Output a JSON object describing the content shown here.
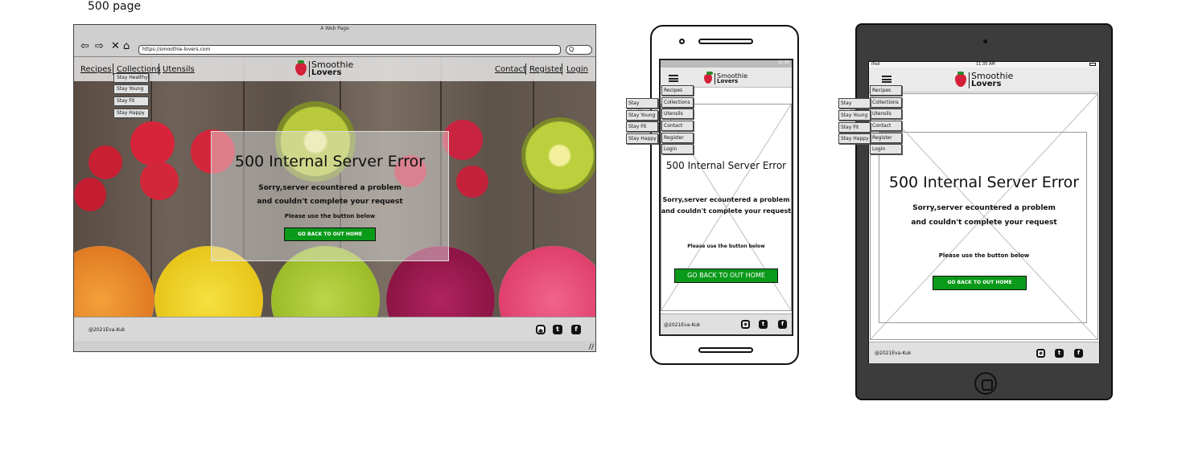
{
  "page_label": "500 page",
  "desktop": {
    "window_title": "A Web Page",
    "url": "https://smoothie-lovers.com",
    "search_glyph": "Q",
    "nav_left": [
      "Recipes",
      "Collections",
      "Utensils"
    ],
    "nav_right": [
      "Contact",
      "Register",
      "Login"
    ],
    "dropdown": [
      "Stay Healthy",
      "Stay Young",
      "Stay Fit",
      "Stay Happy"
    ],
    "logo_line1": "Smoothie",
    "logo_line2": "Lovers",
    "error_title": "500 Internal Server Error",
    "error_line1": "Sorry,server ecountered a problem",
    "error_line2": "and couldn't complete your request",
    "instruction": "Please use the button below",
    "button": "GO BACK TO OUT HOME",
    "copyright": "@2021Eva-Kuk",
    "resize_glyph": "//"
  },
  "phone": {
    "status_time": "11:36",
    "logo_line1": "Smoothie",
    "logo_line2": "Lovers",
    "menu": [
      "Recipes",
      "Collections",
      "Utensils",
      "Contact",
      "Register",
      "Login"
    ],
    "submenu": [
      "Stay Healthy",
      "Stay Young",
      "Stay Fit",
      "Stay Happy"
    ],
    "error_title": "500 Internal Server Error",
    "error_line1": "Sorry,server ecountered a problem",
    "error_line2": "and couldn't complete your request",
    "instruction": "Please use the button below",
    "button": "GO BACK TO OUT HOME",
    "copyright": "@2021Eva-Kuk"
  },
  "tablet": {
    "status_left": "iPad",
    "status_time": "11:35 AM",
    "logo_line1": "Smoothie",
    "logo_line2": "Lovers",
    "menu": [
      "Recipes",
      "Collections",
      "Utensils",
      "Contact",
      "Register",
      "Login"
    ],
    "submenu": [
      "Stay Healthy",
      "Stay Young",
      "Stay Fit",
      "Stay Happy"
    ],
    "error_title": "500 Internal Server Error",
    "error_line1": "Sorry,server ecountered a problem",
    "error_line2": "and couldn't complete your request",
    "instruction": "Please use the button below",
    "button": "GO BACK TO OUT HOME",
    "copyright": "@2021Eva-Kuk"
  },
  "social_icons": [
    "instagram-icon",
    "twitter-icon",
    "facebook-icon"
  ],
  "colors": {
    "button_green": "#0a9a1a",
    "strawberry_red": "#d4213a",
    "tablet_frame": "#3c3c3c"
  }
}
